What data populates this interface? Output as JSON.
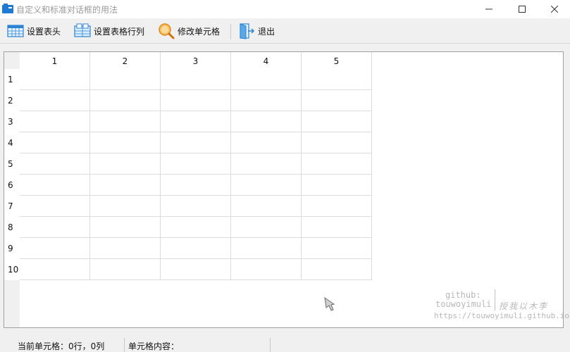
{
  "window": {
    "title": "自定义和标准对话框的用法",
    "controls": {
      "minimize_icon": "minimize-icon",
      "maximize_icon": "maximize-icon",
      "close_icon": "close-icon"
    }
  },
  "toolbar": {
    "items": [
      {
        "label": "设置表头",
        "icon": "table-header-icon"
      },
      {
        "label": "设置表格行列",
        "icon": "table-rows-cols-icon"
      },
      {
        "label": "修改单元格",
        "icon": "magnifier-icon"
      },
      {
        "label": "退出",
        "icon": "exit-door-icon"
      }
    ]
  },
  "grid": {
    "column_headers": [
      "1",
      "2",
      "3",
      "4",
      "5"
    ],
    "row_headers": [
      "1",
      "2",
      "3",
      "4",
      "5",
      "6",
      "7",
      "8",
      "9",
      "10"
    ],
    "cells": [
      [
        "",
        "",
        "",
        "",
        ""
      ],
      [
        "",
        "",
        "",
        "",
        ""
      ],
      [
        "",
        "",
        "",
        "",
        ""
      ],
      [
        "",
        "",
        "",
        "",
        ""
      ],
      [
        "",
        "",
        "",
        "",
        ""
      ],
      [
        "",
        "",
        "",
        "",
        ""
      ],
      [
        "",
        "",
        "",
        "",
        ""
      ],
      [
        "",
        "",
        "",
        "",
        ""
      ],
      [
        "",
        "",
        "",
        "",
        ""
      ],
      [
        "",
        "",
        "",
        "",
        ""
      ]
    ]
  },
  "watermark": {
    "line1": "github:",
    "line2": "touwoyimuli",
    "signature": "授我以木李",
    "url": "https://touwoyimuli.github.io"
  },
  "statusbar": {
    "current_cell": "当前单元格：0行，0列",
    "cell_content": "单元格内容："
  },
  "colors": {
    "accent": "#1e88e5",
    "grid_line": "#dcdcdc",
    "background": "#f0f0f0"
  }
}
